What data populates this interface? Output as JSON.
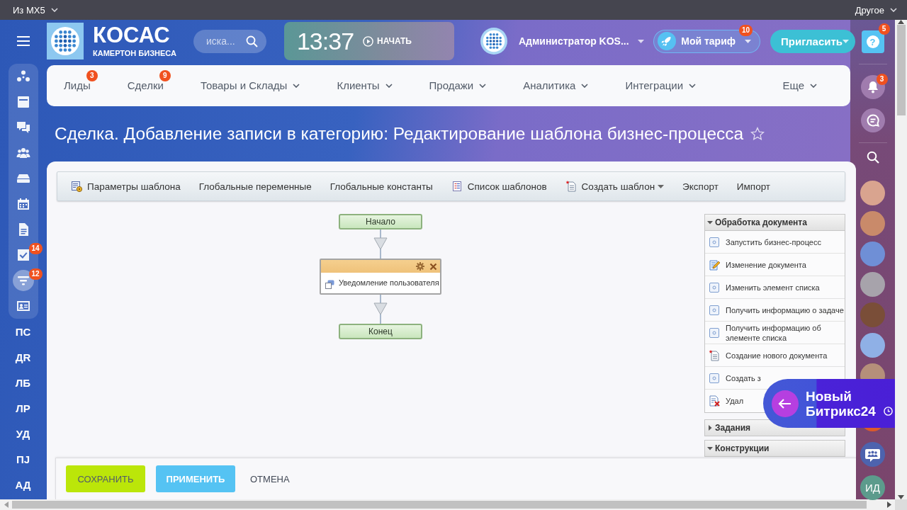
{
  "top_bar": {
    "left_menu": "Из MX5",
    "right_menu": "Другое"
  },
  "header": {
    "brand": {
      "name": "КОСАС",
      "tagline": "КАМЕРТОН БИЗНЕСА"
    },
    "search": {
      "placeholder": "иска..."
    },
    "clock": {
      "time": "13:37",
      "action": "НАЧАТЬ"
    },
    "user": {
      "name": "Администратор KOS..."
    },
    "tariff": {
      "label": "Мой тариф",
      "badge": "10"
    },
    "invite": {
      "label": "Пригласить"
    }
  },
  "left_sidebar": {
    "items": [
      {
        "kind": "icon",
        "selected": false
      },
      {
        "kind": "icon",
        "selected": false
      },
      {
        "kind": "icon",
        "selected": false
      },
      {
        "kind": "icon",
        "selected": false
      },
      {
        "kind": "icon",
        "selected": false
      },
      {
        "kind": "icon",
        "selected": false
      },
      {
        "kind": "icon",
        "selected": false
      },
      {
        "kind": "icon",
        "badge": "14",
        "selected": false
      },
      {
        "kind": "icon",
        "badge": "12",
        "selected": true
      },
      {
        "kind": "icon",
        "selected": false
      },
      {
        "kind": "text",
        "label": "ПС",
        "selected": false
      },
      {
        "kind": "text",
        "label": "ДR",
        "selected": false
      },
      {
        "kind": "text",
        "label": "ЛБ",
        "selected": false
      },
      {
        "kind": "text",
        "label": "ЛР",
        "selected": false
      },
      {
        "kind": "text",
        "label": "УД",
        "selected": false
      },
      {
        "kind": "text",
        "label": "ПJ",
        "selected": false
      },
      {
        "kind": "text",
        "label": "АД",
        "selected": false
      }
    ]
  },
  "nav": {
    "items": [
      {
        "label": "Лиды",
        "badge": "3",
        "dropdown": false
      },
      {
        "label": "Сделки",
        "badge": "9",
        "dropdown": false
      },
      {
        "label": "Товары и Склады",
        "dropdown": true
      },
      {
        "label": "Клиенты",
        "dropdown": true
      },
      {
        "label": "Продажи",
        "dropdown": true
      },
      {
        "label": "Аналитика",
        "dropdown": true
      },
      {
        "label": "Интеграции",
        "dropdown": true
      },
      {
        "label": "Еще",
        "dropdown": true
      }
    ]
  },
  "page": {
    "title": "Сделка. Добавление записи в категорию: Редактирование шаблона бизнес-процесса",
    "favorite": false
  },
  "toolbar": {
    "items": [
      {
        "kind": "icon",
        "label": "Параметры шаблона",
        "dropdown": false
      },
      {
        "kind": "text",
        "label": "Глобальные переменные",
        "dropdown": false
      },
      {
        "kind": "text",
        "label": "Глобальные константы",
        "dropdown": false
      },
      {
        "kind": "icon",
        "label": "Список шаблонов",
        "dropdown": false
      },
      {
        "kind": "icon",
        "label": "Создать шаблон",
        "dropdown": true
      },
      {
        "kind": "text",
        "label": "Экспорт",
        "dropdown": false
      },
      {
        "kind": "text",
        "label": "Импорт",
        "dropdown": false
      }
    ]
  },
  "diagram": {
    "start": "Начало",
    "activities": [
      {
        "title": "Уведомление пользователя"
      }
    ],
    "end": "Конец"
  },
  "activity_panel": {
    "groups": [
      {
        "title": "Обработка документа",
        "expanded": true,
        "items": [
          {
            "label": "Запустить бизнес-процесс"
          },
          {
            "label": "Изменение документа"
          },
          {
            "label": "Изменить элемент списка"
          },
          {
            "label": "Получить информацию о задаче"
          },
          {
            "label": "Получить информацию об элементе списка"
          },
          {
            "label": "Создание нового документа"
          },
          {
            "label": "Создать з"
          },
          {
            "label": "Удал"
          }
        ]
      },
      {
        "title": "Задания",
        "expanded": false
      },
      {
        "title": "Конструкции",
        "expanded": true
      }
    ]
  },
  "footer": {
    "buttons": [
      {
        "kind": "save",
        "label": "СОХРАНИТЬ"
      },
      {
        "kind": "apply",
        "label": "ПРИМЕНИТЬ"
      },
      {
        "kind": "cancel",
        "label": "ОТМЕНА"
      }
    ]
  },
  "right_sidebar": {
    "help": {
      "icon": "?",
      "badge": "5"
    },
    "notifications_badge": "3",
    "contact_initials": "ИД"
  },
  "banner": {
    "title": "Новый Битрикс24"
  }
}
